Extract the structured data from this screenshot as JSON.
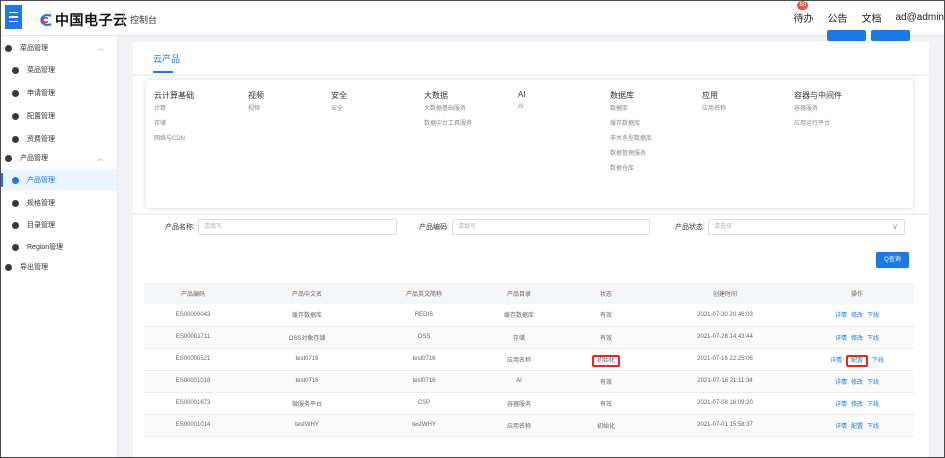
{
  "topbar": {
    "brand": "中国电子云",
    "console": "控制台",
    "badge": "88",
    "links": [
      "待办",
      "公告",
      "文档",
      "ad@admin"
    ]
  },
  "sidebar": [
    {
      "label": "菜品管理",
      "type": "group",
      "chevron": "︿"
    },
    {
      "label": "菜品管理",
      "type": "item"
    },
    {
      "label": "申请管理",
      "type": "item"
    },
    {
      "label": "配置管理",
      "type": "item"
    },
    {
      "label": "资费管理",
      "type": "item"
    },
    {
      "label": "产品管理",
      "type": "group",
      "chevron": "︿"
    },
    {
      "label": "产品管理",
      "type": "item",
      "active": true
    },
    {
      "label": "规格管理",
      "type": "item"
    },
    {
      "label": "目录管理",
      "type": "item"
    },
    {
      "label": "Region管理",
      "type": "item"
    },
    {
      "label": "导出管理",
      "type": "group"
    }
  ],
  "tab": "云产品",
  "categories": [
    {
      "head": "云计算基础",
      "items": [
        "计算",
        "存储",
        "网络与CDN"
      ]
    },
    {
      "head": "视频",
      "items": [
        "视频"
      ]
    },
    {
      "head": "安全",
      "items": [
        "安全"
      ]
    },
    {
      "head": "大数据",
      "items": [
        "大数据基础服务",
        "数据中台工具服务"
      ]
    },
    {
      "head": "AI",
      "items": [
        "AI"
      ]
    },
    {
      "head": "数据库",
      "items": [
        "数据库",
        "缓存数据库",
        "非关系型数据库",
        "数据管理服务",
        "数据仓库"
      ]
    },
    {
      "head": "应用",
      "items": [
        "应用名称"
      ]
    },
    {
      "head": "容器与中间件",
      "items": [
        "容器服务",
        "应用运行平台"
      ]
    }
  ],
  "filters": {
    "name_label": "产品名称:",
    "name_placeholder": "请填写",
    "code_label": "产品编码:",
    "code_placeholder": "请填写",
    "status_label": "产品状态:",
    "status_placeholder": "请选择",
    "search_button": "Q查询"
  },
  "table": {
    "columns": [
      "产品编码",
      "产品中文名",
      "产品英文简称",
      "产品目录",
      "状态",
      "创建时间",
      "操作"
    ],
    "rows": [
      {
        "code": "ES00000043",
        "cn": "缓存数据库",
        "en": "REDIS",
        "dir": "缓存数据库",
        "status": "有效",
        "time": "2021-07-30 20:46:03",
        "actions": [
          "详情",
          "修改",
          "下线"
        ]
      },
      {
        "code": "ES00001711",
        "cn": "OSS对象存储",
        "en": "OSS",
        "dir": "存储",
        "status": "有效",
        "time": "2021-07-28 14:43:44",
        "actions": [
          "详情",
          "修改",
          "下线"
        ]
      },
      {
        "code": "ES00000521",
        "cn": "test0716",
        "en": "test0716",
        "dir": "应用名称",
        "status": "初始化",
        "time": "2021-07-16 22:25:06",
        "actions": [
          "详情",
          "配置",
          "下线"
        ],
        "highlight": true
      },
      {
        "code": "ES00001018",
        "cn": "test0716",
        "en": "test0716",
        "dir": "AI",
        "status": "有效",
        "time": "2021-07-16 21:11:34",
        "actions": [
          "详情",
          "修改",
          "下线"
        ]
      },
      {
        "code": "ES00001673",
        "cn": "微服务平台",
        "en": "CSP",
        "dir": "容器服务",
        "status": "有效",
        "time": "2021-07-08 16:09:20",
        "actions": [
          "详情",
          "修改",
          "下线"
        ]
      },
      {
        "code": "ES00001014",
        "cn": "testWHY",
        "en": "testWHY",
        "dir": "应用名称",
        "status": "初始化",
        "time": "2021-07-01 15:58:37",
        "actions": [
          "详情",
          "配置",
          "下线"
        ]
      }
    ]
  },
  "colors": {
    "accent": "#1b7be3",
    "highlight": "#e8271c",
    "badge": "#e8593c"
  }
}
